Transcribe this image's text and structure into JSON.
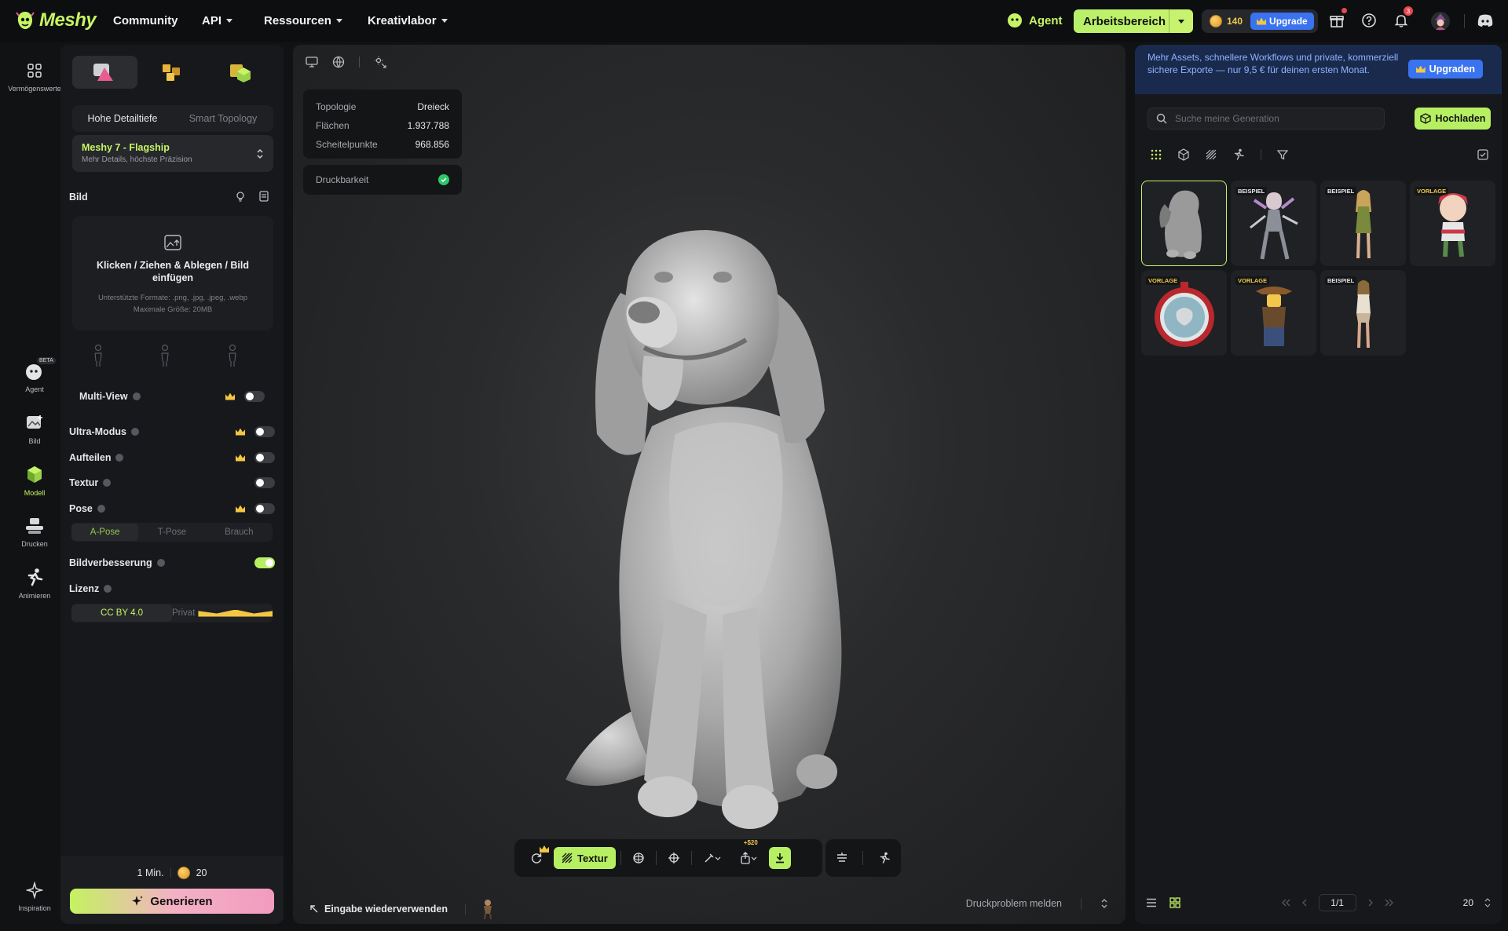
{
  "app": {
    "name": "Meshy"
  },
  "topnav": {
    "items": [
      {
        "label": "Community",
        "dropdown": false
      },
      {
        "label": "API",
        "dropdown": true
      },
      {
        "label": "Ressourcen",
        "dropdown": true
      },
      {
        "label": "Kreativlabor",
        "dropdown": true
      }
    ],
    "agent_label": "Agent",
    "workspace_label": "Arbeitsbereich",
    "credits": "140",
    "upgrade_label": "Upgrade",
    "notification_count": "3"
  },
  "rail": {
    "items": [
      {
        "label": "Vermögenswerte",
        "icon": "assets-grid-icon"
      },
      {
        "label": "Agent",
        "badge": "BETA",
        "icon": "agent-icon"
      },
      {
        "label": "Bild",
        "icon": "image-add-icon"
      },
      {
        "label": "Modell",
        "icon": "model-cube-icon",
        "active": true
      },
      {
        "label": "Drucken",
        "icon": "printer-icon"
      },
      {
        "label": "Animieren",
        "icon": "running-figure-icon"
      },
      {
        "label": "Inspiration",
        "icon": "sparkle-icon"
      }
    ]
  },
  "left": {
    "quality_tabs": [
      "Hohe Detailtiefe",
      "Smart Topology"
    ],
    "model_title": "Meshy 7 - Flagship",
    "model_sub": "Mehr Details, höchste Präzision",
    "image_section": "Bild",
    "dropzone_main": "Klicken / Ziehen & Ablegen / Bild einfügen",
    "dropzone_formats": "Unterstützte Formate: .png, .jpg, .jpeg, .webp",
    "dropzone_max": "Maximale Größe: 20MB",
    "options": [
      {
        "label": "Multi-View",
        "premium": true,
        "on": false
      },
      {
        "label": "Ultra-Modus",
        "premium": true,
        "on": false
      },
      {
        "label": "Aufteilen",
        "premium": true,
        "on": false
      },
      {
        "label": "Textur",
        "premium": false,
        "on": false
      },
      {
        "label": "Pose",
        "premium": true,
        "on": false
      }
    ],
    "poses": [
      "A-Pose",
      "T-Pose",
      "Brauch"
    ],
    "enhance_label": "Bildverbesserung",
    "enhance_on": true,
    "license_label": "Lizenz",
    "licenses": [
      "CC BY 4.0",
      "Privat"
    ],
    "time": "1 Min.",
    "cost": "20",
    "generate_label": "Generieren"
  },
  "viewer": {
    "stats": [
      {
        "k": "Topologie",
        "v": "Dreieck"
      },
      {
        "k": "Flächen",
        "v": "1.937.788"
      },
      {
        "k": "Scheitelpunkte",
        "v": "968.856"
      }
    ],
    "printability_label": "Druckbarkeit",
    "texture_label": "Textur",
    "export_cost": "+$20",
    "reuse_label": "Eingabe wiederverwenden",
    "report_label": "Druckproblem melden"
  },
  "right": {
    "promo_text": "Mehr Assets, schnellere Workflows und private, kommerziell sichere Exporte — nur 9,5 € für deinen ersten Monat.",
    "promo_button": "Upgraden",
    "search_placeholder": "Suche meine Generation",
    "upload_label": "Hochladen",
    "cards": [
      {
        "tag": ""
      },
      {
        "tag": "BEISPIEL"
      },
      {
        "tag": "BEISPIEL"
      },
      {
        "tag": "VORLAGE"
      },
      {
        "tag": "VORLAGE"
      },
      {
        "tag": "VORLAGE"
      },
      {
        "tag": "BEISPIEL"
      }
    ],
    "page": "1/1",
    "per_page": "20"
  },
  "colors": {
    "accent": "#c7f464",
    "accent_button": "#b7ef62",
    "upgrade_blue": "#3a73f0",
    "background": "#111214"
  }
}
